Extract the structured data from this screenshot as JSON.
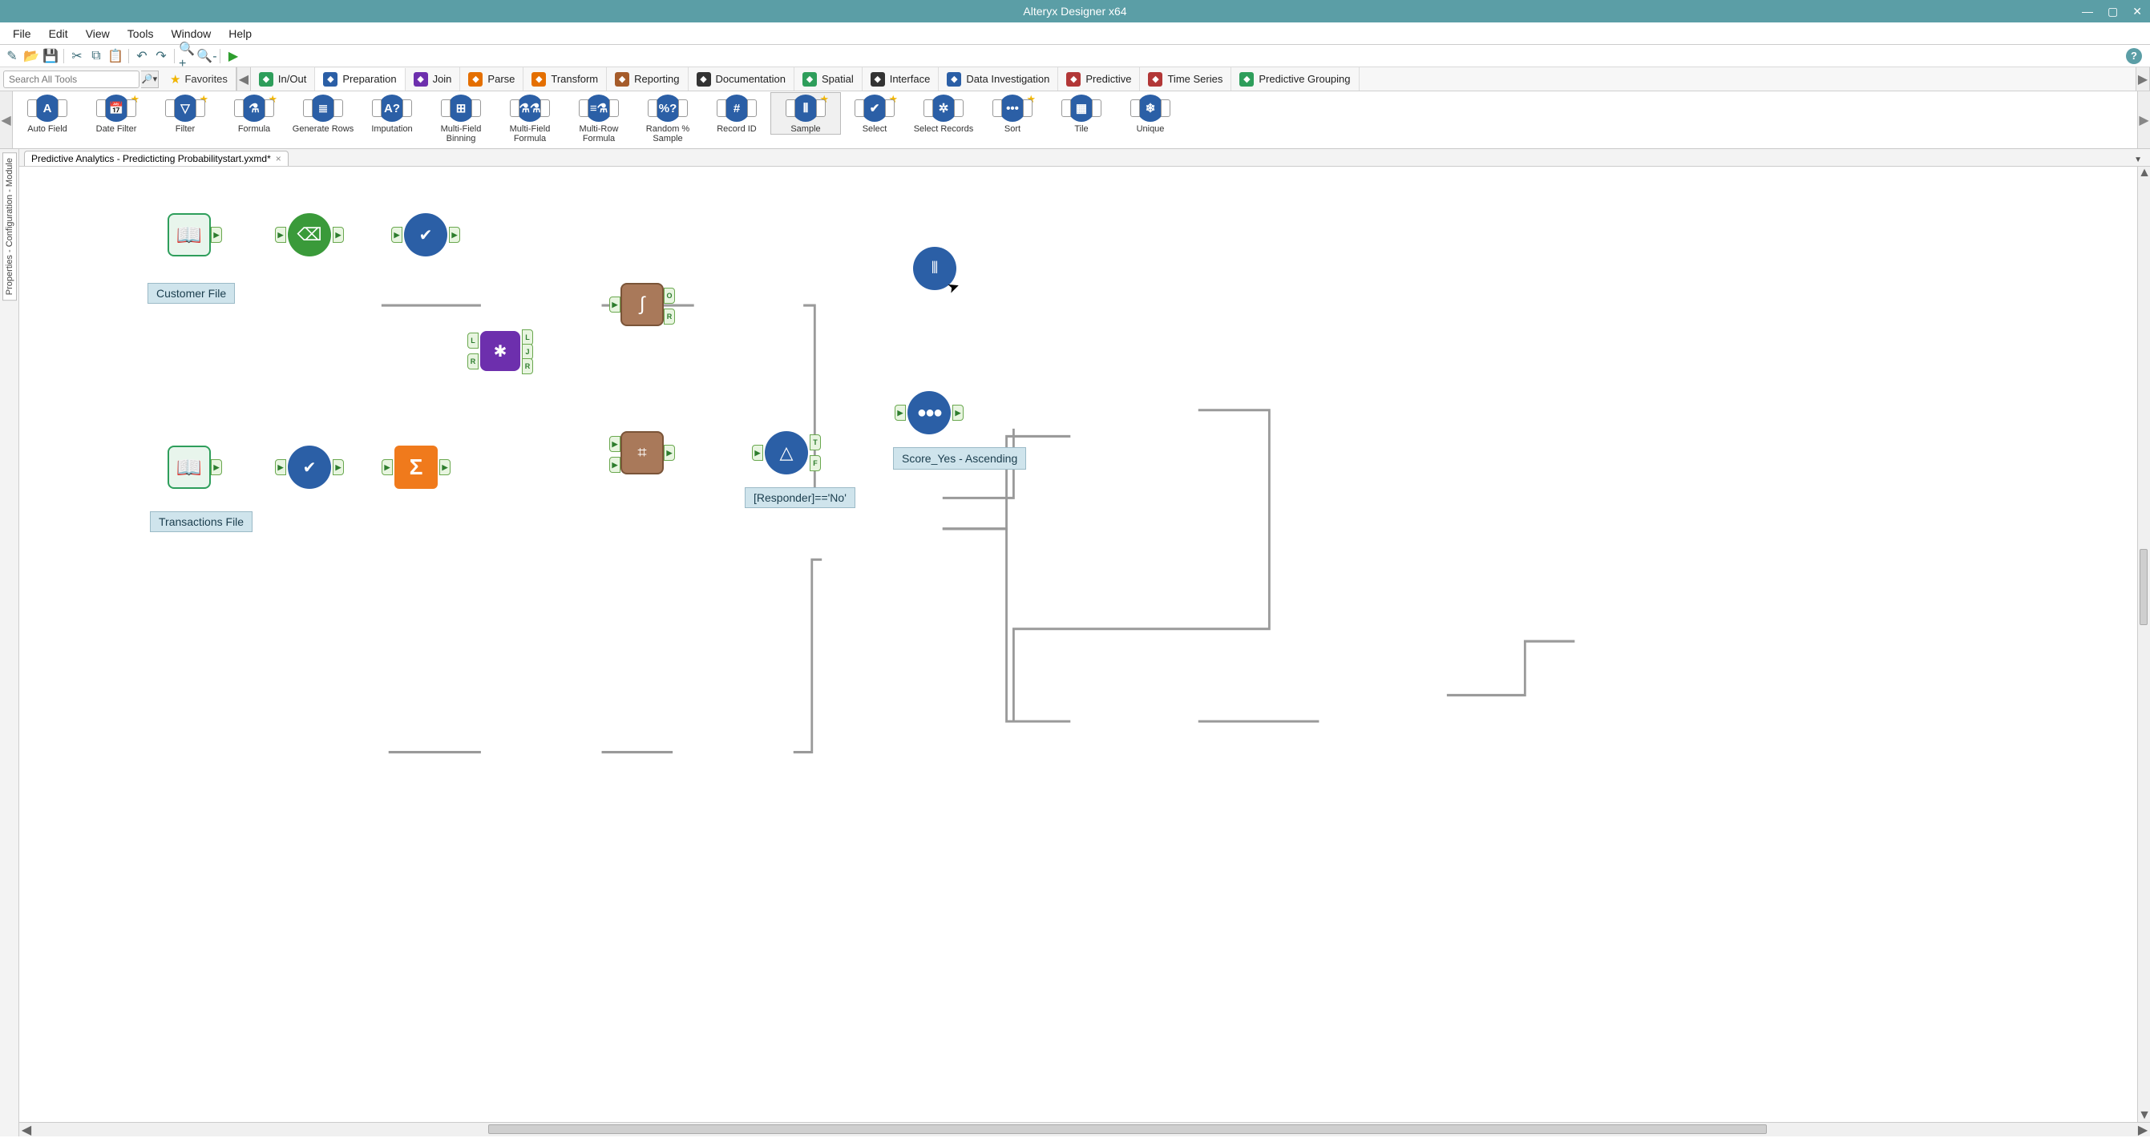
{
  "window": {
    "title": "Alteryx Designer x64",
    "min": "—",
    "max": "▢",
    "close": "✕"
  },
  "menu": [
    "File",
    "Edit",
    "View",
    "Tools",
    "Window",
    "Help"
  ],
  "search": {
    "placeholder": "Search All Tools"
  },
  "favorites_label": "Favorites",
  "categories": [
    {
      "label": "In/Out",
      "color": "#2e9e5b"
    },
    {
      "label": "Preparation",
      "color": "#2b5fa6"
    },
    {
      "label": "Join",
      "color": "#6d2fad"
    },
    {
      "label": "Parse",
      "color": "#e46f00"
    },
    {
      "label": "Transform",
      "color": "#e46f00"
    },
    {
      "label": "Reporting",
      "color": "#a55b2a"
    },
    {
      "label": "Documentation",
      "color": "#333333"
    },
    {
      "label": "Spatial",
      "color": "#2e9e5b"
    },
    {
      "label": "Interface",
      "color": "#333333"
    },
    {
      "label": "Data Investigation",
      "color": "#2b5fa6"
    },
    {
      "label": "Predictive",
      "color": "#b23737"
    },
    {
      "label": "Time Series",
      "color": "#b23737"
    },
    {
      "label": "Predictive Grouping",
      "color": "#2e9e5b"
    }
  ],
  "palette": [
    {
      "label": "Auto Field",
      "g": "A",
      "star": false
    },
    {
      "label": "Date Filter",
      "g": "📅",
      "star": true
    },
    {
      "label": "Filter",
      "g": "▽",
      "star": true
    },
    {
      "label": "Formula",
      "g": "⚗",
      "star": true
    },
    {
      "label": "Generate Rows",
      "g": "≣",
      "star": false
    },
    {
      "label": "Imputation",
      "g": "A?",
      "star": false
    },
    {
      "label": "Multi-Field Binning",
      "g": "⊞",
      "star": false
    },
    {
      "label": "Multi-Field Formula",
      "g": "⚗⚗",
      "star": false
    },
    {
      "label": "Multi-Row Formula",
      "g": "≡⚗",
      "star": false
    },
    {
      "label": "Random % Sample",
      "g": "%?",
      "star": false
    },
    {
      "label": "Record ID",
      "g": "#",
      "star": false
    },
    {
      "label": "Sample",
      "g": "⦀",
      "star": true,
      "selected": true
    },
    {
      "label": "Select",
      "g": "✔",
      "star": true
    },
    {
      "label": "Select Records",
      "g": "✲",
      "star": false
    },
    {
      "label": "Sort",
      "g": "•••",
      "star": true
    },
    {
      "label": "Tile",
      "g": "▦",
      "star": false
    },
    {
      "label": "Unique",
      "g": "❄",
      "star": false
    }
  ],
  "document": {
    "tab_title": "Predictive Analytics - Predicticting Probabilitystart.yxmd*"
  },
  "sidetabs": [
    "Properties - Configuration - Module"
  ],
  "canvas": {
    "labels": {
      "customer": "Customer File",
      "transactions": "Transactions File",
      "filter_expr": "[Responder]=='No'",
      "sort_expr": "Score_Yes - Ascending"
    },
    "join_anchors": {
      "L": "L",
      "J": "J",
      "R": "R"
    },
    "logistic_anchors": {
      "O": "O",
      "R": "R"
    },
    "filter_anchors": {
      "T": "T",
      "F": "F"
    }
  }
}
